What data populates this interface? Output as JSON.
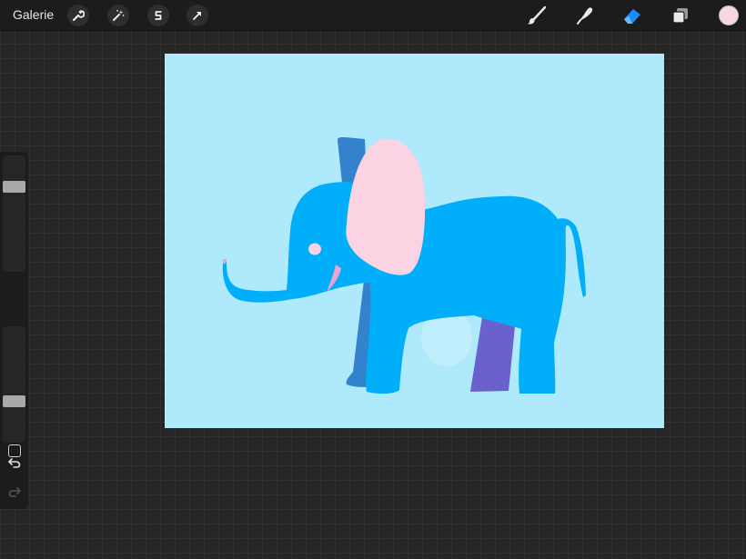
{
  "topbar": {
    "gallery_label": "Galerie",
    "left_tools": [
      {
        "name": "actions",
        "icon": "wrench-icon"
      },
      {
        "name": "adjustments",
        "icon": "magic-wand-icon"
      },
      {
        "name": "selection",
        "icon": "selection-s-icon"
      },
      {
        "name": "transform",
        "icon": "arrow-cursor-icon"
      }
    ],
    "right_tools": [
      {
        "name": "brush",
        "icon": "brush-icon",
        "active": false
      },
      {
        "name": "smudge",
        "icon": "smudge-finger-icon",
        "active": false
      },
      {
        "name": "eraser",
        "icon": "eraser-icon",
        "active": true
      },
      {
        "name": "layers",
        "icon": "layers-icon",
        "active": false
      }
    ],
    "current_color": "#f9d6e4"
  },
  "canvas": {
    "background": "#aee9fc",
    "subject": "elephant-drawing",
    "colors": {
      "body": "#00aef9",
      "shadow_parts": "#3582cc",
      "ear": "#fbd3e3",
      "back_leg": "#6a61cc"
    }
  },
  "sidebar": {
    "brush_size_level": 0.76,
    "opacity_level": 0.34,
    "modifier_icon": "square-modifier-icon",
    "undo_icon": "undo-arrow-icon",
    "redo_icon": "redo-arrow-icon",
    "redo_enabled": false
  }
}
